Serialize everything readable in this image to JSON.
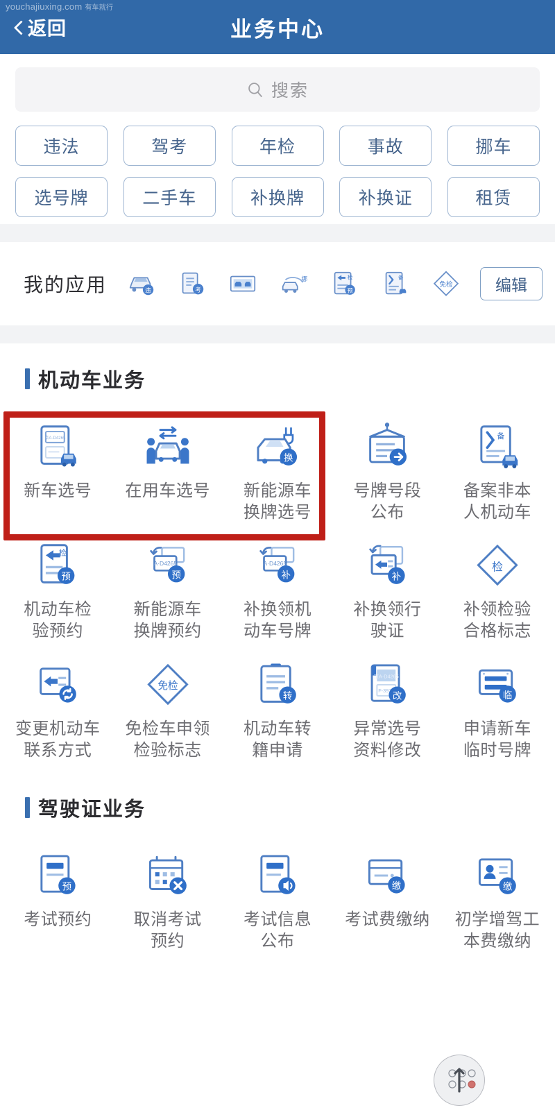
{
  "watermark": {
    "domain": "youchajiuxing.com",
    "cn": "有车就行"
  },
  "header": {
    "back_label": "返回",
    "title": "业务中心",
    "back_icon": "chevron-left-icon",
    "bg_color": "#3169a8"
  },
  "search": {
    "placeholder": "搜索",
    "icon": "search-icon"
  },
  "chips": {
    "row1": [
      "违法",
      "驾考",
      "年检",
      "事故",
      "挪车"
    ],
    "row2": [
      "选号牌",
      "二手车",
      "补换牌",
      "补换证",
      "租赁"
    ]
  },
  "my_apps": {
    "title": "我的应用",
    "edit_label": "编辑",
    "icons": [
      "car-violation-icon",
      "document-exam-icon",
      "accident-photo-icon",
      "move-car-icon",
      "inspection-booking-icon",
      "license-record-icon",
      "exempt-inspection-icon"
    ]
  },
  "sections": [
    {
      "title": "机动车业务",
      "accent": "#3a6fb0",
      "highlight": {
        "color": "#bf1f18",
        "covers": 3
      },
      "items": [
        {
          "label": "新车选号",
          "icon": "new-car-plate-select-icon"
        },
        {
          "label": "在用车选号",
          "icon": "in-use-car-plate-select-icon"
        },
        {
          "label": "新能源车\n换牌选号",
          "icon": "new-energy-plate-change-icon"
        },
        {
          "label": "号牌号段\n公布",
          "icon": "plate-number-range-icon"
        },
        {
          "label": "备案非本\n人机动车",
          "icon": "record-other-vehicle-icon"
        },
        {
          "label": "机动车检\n验预约",
          "icon": "vehicle-inspection-booking-icon"
        },
        {
          "label": "新能源车\n换牌预约",
          "icon": "new-energy-plate-booking-icon"
        },
        {
          "label": "补换领机\n动车号牌",
          "icon": "replace-vehicle-plate-icon"
        },
        {
          "label": "补换领行\n驶证",
          "icon": "replace-driving-permit-icon"
        },
        {
          "label": "补领检验\n合格标志",
          "icon": "replace-inspection-mark-icon"
        },
        {
          "label": "变更机动车\n联系方式",
          "icon": "change-vehicle-contact-icon"
        },
        {
          "label": "免检车申领\n检验标志",
          "icon": "exempt-inspection-apply-icon"
        },
        {
          "label": "机动车转\n籍申请",
          "icon": "vehicle-transfer-icon"
        },
        {
          "label": "异常选号\n资料修改",
          "icon": "abnormal-plate-edit-icon"
        },
        {
          "label": "申请新车\n临时号牌",
          "icon": "temporary-plate-icon"
        }
      ]
    },
    {
      "title": "驾驶证业务",
      "accent": "#3a6fb0",
      "items": [
        {
          "label": "考试预约",
          "icon": "exam-booking-icon"
        },
        {
          "label": "取消考试\n预约",
          "icon": "cancel-exam-booking-icon"
        },
        {
          "label": "考试信息\n公布",
          "icon": "exam-info-announce-icon"
        },
        {
          "label": "考试费缴纳",
          "icon": "exam-fee-payment-icon"
        },
        {
          "label": "初学增驾工\n本费缴纳",
          "icon": "license-fee-payment-icon"
        }
      ]
    }
  ],
  "plate_sample": "A·D4265",
  "float_widget": {
    "icon": "assistive-touch-icon"
  }
}
